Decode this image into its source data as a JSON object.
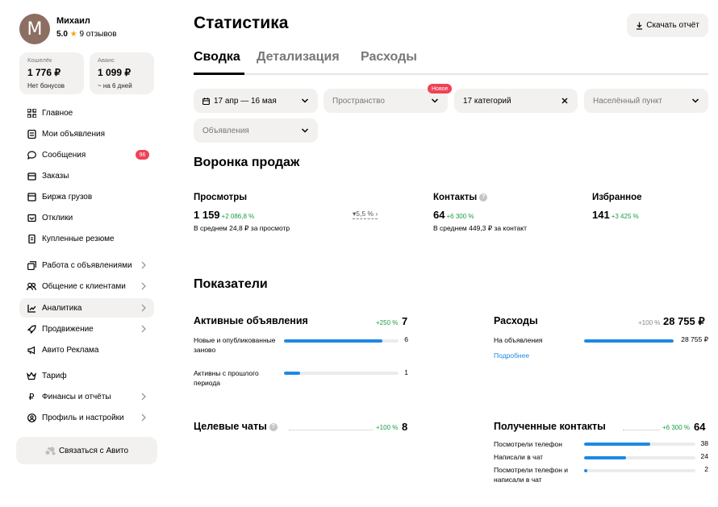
{
  "user": {
    "avatar_letter": "М",
    "name": "Михаил",
    "rating": "5.0",
    "reviews": "9 отзывов"
  },
  "wallet": {
    "label": "Кошелёк",
    "amount": "1 776 ₽",
    "sub": "Нет бонусов"
  },
  "advance": {
    "label": "Аванс",
    "amount": "1 099 ₽",
    "sub": "~ на 6 дней"
  },
  "nav": {
    "main": [
      {
        "label": "Главное",
        "icon": "grid-icon"
      },
      {
        "label": "Мои объявления",
        "icon": "list-icon"
      },
      {
        "label": "Сообщения",
        "icon": "chat-icon",
        "badge": "96"
      },
      {
        "label": "Заказы",
        "icon": "box-icon"
      },
      {
        "label": "Биржа грузов",
        "icon": "truck-icon"
      },
      {
        "label": "Отклики",
        "icon": "inbox-icon"
      },
      {
        "label": "Купленные резюме",
        "icon": "document-icon"
      }
    ],
    "tools": [
      {
        "label": "Работа с объявлениями",
        "icon": "layers-icon"
      },
      {
        "label": "Общение с клиентами",
        "icon": "people-icon"
      },
      {
        "label": "Аналитика",
        "icon": "chart-icon"
      },
      {
        "label": "Продвижение",
        "icon": "rocket-icon"
      },
      {
        "label": "Авито Реклама",
        "icon": "megaphone-icon"
      }
    ],
    "account": [
      {
        "label": "Тариф",
        "icon": "crown-icon"
      },
      {
        "label": "Финансы и отчёты",
        "icon": "ruble-icon"
      },
      {
        "label": "Профиль и настройки",
        "icon": "user-circle-icon"
      }
    ],
    "contact_button": "Связаться с Авито"
  },
  "page": {
    "title": "Статистика",
    "download": "Скачать отчёт",
    "tabs": [
      "Сводка",
      "Детализация",
      "Расходы"
    ]
  },
  "filters": {
    "period": "17 апр — 16 мая",
    "space": "Пространство",
    "new_badge": "Новое",
    "categories": "17 категорий",
    "locality": "Населённый пункт",
    "ads": "Объявления"
  },
  "funnel": {
    "title": "Воронка продаж",
    "views": {
      "title": "Просмотры",
      "value": "1 159",
      "delta": "+2 086,8 %",
      "sub": "В среднем 24,8 ₽ за просмотр"
    },
    "conversion": "5,5 %",
    "contacts": {
      "title": "Контакты",
      "value": "64",
      "delta": "+6 300 %",
      "sub": "В среднем 449,3 ₽ за контакт"
    },
    "favorites": {
      "title": "Избранное",
      "value": "141",
      "delta": "+3 425 %"
    }
  },
  "indicators": {
    "title": "Показатели",
    "active_ads": {
      "title": "Активные объявления",
      "delta": "+250 %",
      "value": "7",
      "rows": [
        {
          "label": "Новые и опубликованные заново",
          "num": "6",
          "fill": 0.857
        },
        {
          "label": "Активны с прошлого периода",
          "num": "1",
          "fill": 0.143
        }
      ]
    },
    "expenses": {
      "title": "Расходы",
      "delta": "+100 %",
      "value": "28 755 ₽",
      "rows": [
        {
          "label": "На объявления",
          "num": "28 755 ₽",
          "fill": 1.0
        }
      ],
      "link": "Подробнее"
    },
    "target_chats": {
      "title": "Целевые чаты",
      "delta": "+100 %",
      "value": "8"
    },
    "received_contacts": {
      "title": "Полученные контакты",
      "delta": "+6 300 %",
      "value": "64",
      "rows": [
        {
          "label": "Посмотрели телефон",
          "num": "38",
          "fill": 0.594
        },
        {
          "label": "Написали в чат",
          "num": "24",
          "fill": 0.375
        },
        {
          "label": "Посмотрели телефон и написали в чат",
          "num": "2",
          "fill": 0.031
        }
      ]
    }
  },
  "colors": {
    "accent": "#1e88e5",
    "positive": "#1a9c47",
    "badge": "#ef4257",
    "surface": "#f2f1f0"
  }
}
